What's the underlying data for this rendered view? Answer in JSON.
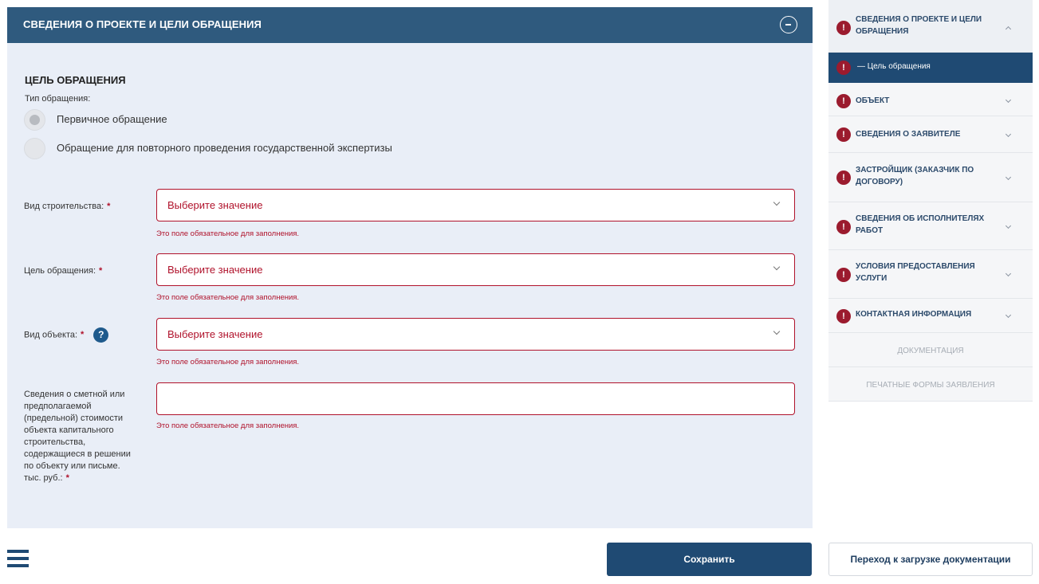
{
  "panel": {
    "title": "СВЕДЕНИЯ О ПРОЕКТЕ И ЦЕЛИ ОБРАЩЕНИЯ",
    "section_title": "ЦЕЛЬ ОБРАЩЕНИЯ",
    "type_label": "Тип обращения:",
    "radio_options": [
      {
        "label": "Первичное обращение",
        "checked": true
      },
      {
        "label": "Обращение для повторного проведения государственной экспертизы",
        "checked": false
      }
    ],
    "fields": {
      "construction_type": {
        "label": "Вид строительства:",
        "value": "Выберите значение",
        "error": "Это поле обязательное для заполнения."
      },
      "purpose": {
        "label": "Цель обращения:",
        "value": "Выберите значение",
        "error": "Это поле обязательное для заполнения."
      },
      "object_type": {
        "label": "Вид объекта:",
        "value": "Выберите значение",
        "error": "Это поле обязательное для заполнения.",
        "help": "?"
      },
      "cost": {
        "label": "Сведения о сметной или предполагаемой (предельной) стоимости объекта капитального строительства, содержащиеся в решении по объекту или письме. тыс. руб.:",
        "value": "",
        "error": "Это поле обязательное для заполнения."
      }
    },
    "required_mark": "*"
  },
  "sidebar": {
    "items": [
      {
        "label": "СВЕДЕНИЯ О ПРОЕКТЕ И ЦЕЛИ ОБРАЩЕНИЯ",
        "error": true,
        "expanded": true
      },
      {
        "label": "ОБЪЕКТ",
        "error": true
      },
      {
        "label": "СВЕДЕНИЯ О ЗАЯВИТЕЛЕ",
        "error": true
      },
      {
        "label": "ЗАСТРОЙЩИК (ЗАКАЗЧИК ПО ДОГОВОРУ)",
        "error": true
      },
      {
        "label": "СВЕДЕНИЯ ОБ ИСПОЛНИТЕЛЯХ РАБОТ",
        "error": true
      },
      {
        "label": "УСЛОВИЯ ПРЕДОСТАВЛЕНИЯ УСЛУГИ",
        "error": true
      },
      {
        "label": "КОНТАКТНАЯ ИНФОРМАЦИЯ",
        "error": true
      },
      {
        "label": "ДОКУМЕНТАЦИЯ",
        "disabled": true
      },
      {
        "label": "ПЕЧАТНЫЕ ФОРМЫ ЗАЯВЛЕНИЯ",
        "disabled": true
      }
    ],
    "sub_item": {
      "label": "— Цель обращения"
    },
    "error_glyph": "!"
  },
  "footer": {
    "save_label": "Сохранить",
    "upload_label": "Переход к загрузке документации"
  },
  "colors": {
    "header_bg": "#2f5a7e",
    "panel_bg": "#e9eef7",
    "error_red": "#b0122b",
    "primary_blue": "#1f4a73",
    "error_badge": "#9b1b2e"
  }
}
